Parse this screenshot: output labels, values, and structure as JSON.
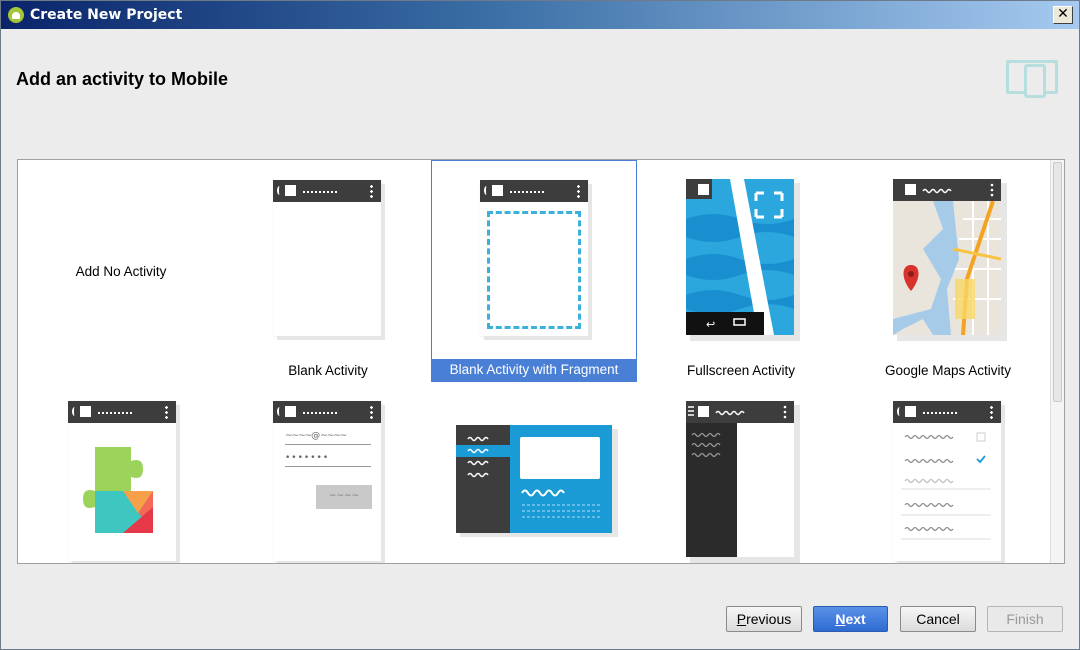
{
  "window": {
    "title": "Create New Project",
    "close_glyph": "✕"
  },
  "header": {
    "page_title": "Add an activity to Mobile",
    "form_factor_icon": "mobile-device-icon"
  },
  "gallery": {
    "tiles": [
      {
        "label": "Add No Activity",
        "selected": false
      },
      {
        "label": "Blank Activity",
        "selected": false
      },
      {
        "label": "Blank Activity with Fragment",
        "selected": true
      },
      {
        "label": "Fullscreen Activity",
        "selected": false
      },
      {
        "label": "Google Maps Activity",
        "selected": false
      },
      {
        "label": "",
        "selected": false,
        "preview": "google-play-services"
      },
      {
        "label": "",
        "selected": false,
        "preview": "login-form"
      },
      {
        "label": "",
        "selected": false,
        "preview": "master-detail-flow"
      },
      {
        "label": "",
        "selected": false,
        "preview": "navigation-drawer"
      },
      {
        "label": "",
        "selected": false,
        "preview": "settings-list"
      }
    ]
  },
  "login_preview": {
    "email_char": "@"
  },
  "buttons": {
    "previous_mnemonic": "P",
    "previous_rest": "revious",
    "next_mnemonic": "N",
    "next_rest": "ext",
    "cancel": "Cancel",
    "finish": "Finish"
  },
  "colors": {
    "accent": "#4a7fd6",
    "phone_bar": "#3d3d3d",
    "ocean": "#2ba7dd",
    "dashed": "#3bb0dc"
  }
}
